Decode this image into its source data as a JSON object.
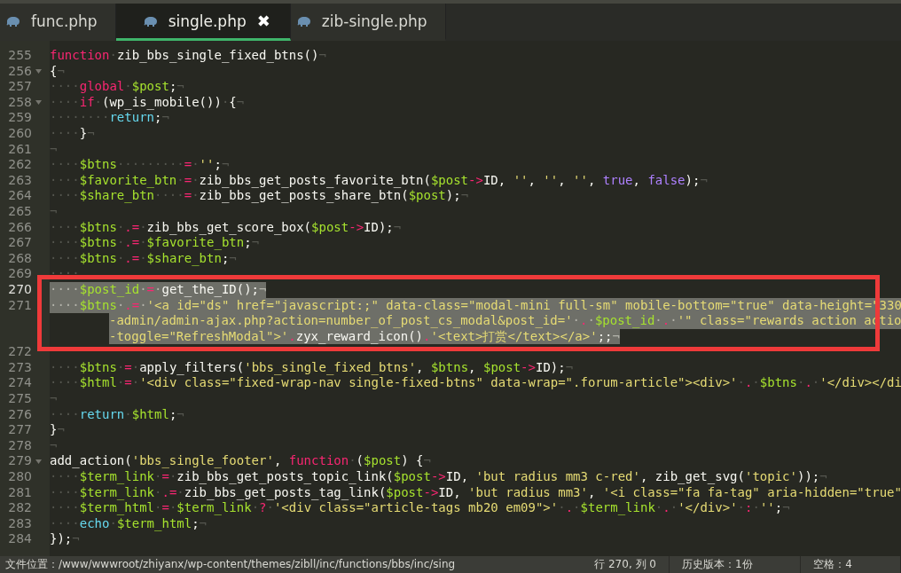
{
  "tabs": [
    {
      "label": "func.php",
      "selected": false,
      "closable": false
    },
    {
      "label": "single.php",
      "selected": true,
      "closable": true
    },
    {
      "label": "zib-single.php",
      "selected": false,
      "closable": false
    }
  ],
  "close_glyph": "✖",
  "editor": {
    "lines": [
      {
        "number": "255",
        "foldable": false,
        "current": false,
        "selected": false,
        "rows": [
          {
            "tokens": [
              {
                "kind": "keyword",
                "text": "function"
              },
              {
                "kind": "ws",
                "text": "·"
              },
              {
                "kind": "plain",
                "text": "zib_bbs_single_fixed_btns()"
              },
              {
                "kind": "ws",
                "text": "¬"
              }
            ]
          }
        ]
      },
      {
        "number": "256",
        "foldable": true,
        "current": false,
        "selected": false,
        "rows": [
          {
            "tokens": [
              {
                "kind": "plain",
                "text": "{"
              },
              {
                "kind": "ws",
                "text": "¬"
              }
            ]
          }
        ]
      },
      {
        "number": "257",
        "foldable": false,
        "current": false,
        "selected": false,
        "rows": [
          {
            "tokens": [
              {
                "kind": "ws",
                "text": "····"
              },
              {
                "kind": "keyword",
                "text": "global"
              },
              {
                "kind": "ws",
                "text": "·"
              },
              {
                "kind": "variable",
                "text": "$post"
              },
              {
                "kind": "plain",
                "text": ";"
              },
              {
                "kind": "ws",
                "text": "¬"
              }
            ]
          }
        ]
      },
      {
        "number": "258",
        "foldable": true,
        "current": false,
        "selected": false,
        "rows": [
          {
            "tokens": [
              {
                "kind": "ws",
                "text": "····"
              },
              {
                "kind": "keyword",
                "text": "if"
              },
              {
                "kind": "ws",
                "text": "·"
              },
              {
                "kind": "plain",
                "text": "(wp_is_mobile())"
              },
              {
                "kind": "ws",
                "text": "·"
              },
              {
                "kind": "plain",
                "text": "{"
              },
              {
                "kind": "ws",
                "text": "¬"
              }
            ]
          }
        ]
      },
      {
        "number": "259",
        "foldable": false,
        "current": false,
        "selected": false,
        "rows": [
          {
            "tokens": [
              {
                "kind": "ws",
                "text": "········"
              },
              {
                "kind": "control",
                "text": "return"
              },
              {
                "kind": "plain",
                "text": ";"
              },
              {
                "kind": "ws",
                "text": "¬"
              }
            ]
          }
        ]
      },
      {
        "number": "260",
        "foldable": false,
        "current": false,
        "selected": false,
        "rows": [
          {
            "tokens": [
              {
                "kind": "ws",
                "text": "····"
              },
              {
                "kind": "plain",
                "text": "}"
              },
              {
                "kind": "ws",
                "text": "¬"
              }
            ]
          }
        ]
      },
      {
        "number": "261",
        "foldable": false,
        "current": false,
        "selected": false,
        "rows": [
          {
            "tokens": [
              {
                "kind": "ws",
                "text": "¬"
              }
            ]
          }
        ]
      },
      {
        "number": "262",
        "foldable": false,
        "current": false,
        "selected": false,
        "rows": [
          {
            "tokens": [
              {
                "kind": "ws",
                "text": "····"
              },
              {
                "kind": "variable",
                "text": "$btns"
              },
              {
                "kind": "ws",
                "text": "·········"
              },
              {
                "kind": "operator",
                "text": "="
              },
              {
                "kind": "ws",
                "text": "·"
              },
              {
                "kind": "string",
                "text": "''"
              },
              {
                "kind": "plain",
                "text": ";"
              },
              {
                "kind": "ws",
                "text": "¬"
              }
            ]
          }
        ]
      },
      {
        "number": "263",
        "foldable": false,
        "current": false,
        "selected": false,
        "rows": [
          {
            "tokens": [
              {
                "kind": "ws",
                "text": "····"
              },
              {
                "kind": "variable",
                "text": "$favorite_btn"
              },
              {
                "kind": "ws",
                "text": "·"
              },
              {
                "kind": "operator",
                "text": "="
              },
              {
                "kind": "ws",
                "text": "·"
              },
              {
                "kind": "plain",
                "text": "zib_bbs_get_posts_favorite_btn("
              },
              {
                "kind": "variable",
                "text": "$post"
              },
              {
                "kind": "operator",
                "text": "->"
              },
              {
                "kind": "plain",
                "text": "ID, "
              },
              {
                "kind": "string",
                "text": "''"
              },
              {
                "kind": "plain",
                "text": ", "
              },
              {
                "kind": "string",
                "text": "''"
              },
              {
                "kind": "plain",
                "text": ", "
              },
              {
                "kind": "string",
                "text": "''"
              },
              {
                "kind": "plain",
                "text": ", "
              },
              {
                "kind": "constant",
                "text": "true"
              },
              {
                "kind": "plain",
                "text": ", "
              },
              {
                "kind": "constant",
                "text": "false"
              },
              {
                "kind": "plain",
                "text": ");"
              },
              {
                "kind": "ws",
                "text": "¬"
              }
            ]
          }
        ]
      },
      {
        "number": "264",
        "foldable": false,
        "current": false,
        "selected": false,
        "rows": [
          {
            "tokens": [
              {
                "kind": "ws",
                "text": "····"
              },
              {
                "kind": "variable",
                "text": "$share_btn"
              },
              {
                "kind": "ws",
                "text": "····"
              },
              {
                "kind": "operator",
                "text": "="
              },
              {
                "kind": "ws",
                "text": "·"
              },
              {
                "kind": "plain",
                "text": "zib_bbs_get_posts_share_btn("
              },
              {
                "kind": "variable",
                "text": "$post"
              },
              {
                "kind": "plain",
                "text": ");"
              },
              {
                "kind": "ws",
                "text": "¬"
              }
            ]
          }
        ]
      },
      {
        "number": "265",
        "foldable": false,
        "current": false,
        "selected": false,
        "rows": [
          {
            "tokens": [
              {
                "kind": "ws",
                "text": "¬"
              }
            ]
          }
        ]
      },
      {
        "number": "266",
        "foldable": false,
        "current": false,
        "selected": false,
        "rows": [
          {
            "tokens": [
              {
                "kind": "ws",
                "text": "····"
              },
              {
                "kind": "variable",
                "text": "$btns"
              },
              {
                "kind": "ws",
                "text": "·"
              },
              {
                "kind": "operator",
                "text": ".="
              },
              {
                "kind": "ws",
                "text": "·"
              },
              {
                "kind": "plain",
                "text": "zib_bbs_get_score_box("
              },
              {
                "kind": "variable",
                "text": "$post"
              },
              {
                "kind": "operator",
                "text": "->"
              },
              {
                "kind": "plain",
                "text": "ID);"
              },
              {
                "kind": "ws",
                "text": "¬"
              }
            ]
          }
        ]
      },
      {
        "number": "267",
        "foldable": false,
        "current": false,
        "selected": false,
        "rows": [
          {
            "tokens": [
              {
                "kind": "ws",
                "text": "····"
              },
              {
                "kind": "variable",
                "text": "$btns"
              },
              {
                "kind": "ws",
                "text": "·"
              },
              {
                "kind": "operator",
                "text": ".="
              },
              {
                "kind": "ws",
                "text": "·"
              },
              {
                "kind": "variable",
                "text": "$favorite_btn"
              },
              {
                "kind": "plain",
                "text": ";"
              },
              {
                "kind": "ws",
                "text": "¬"
              }
            ]
          }
        ]
      },
      {
        "number": "268",
        "foldable": false,
        "current": false,
        "selected": false,
        "rows": [
          {
            "tokens": [
              {
                "kind": "ws",
                "text": "····"
              },
              {
                "kind": "variable",
                "text": "$btns"
              },
              {
                "kind": "ws",
                "text": "·"
              },
              {
                "kind": "operator",
                "text": ".="
              },
              {
                "kind": "ws",
                "text": "·"
              },
              {
                "kind": "variable",
                "text": "$share_btn"
              },
              {
                "kind": "plain",
                "text": ";"
              },
              {
                "kind": "ws",
                "text": "¬"
              }
            ]
          }
        ]
      },
      {
        "number": "269",
        "foldable": false,
        "current": false,
        "selected": false,
        "rows": [
          {
            "tokens": [
              {
                "kind": "ws",
                "text": "····"
              }
            ]
          }
        ]
      },
      {
        "number": "270",
        "foldable": false,
        "current": true,
        "selected": true,
        "rows": [
          {
            "tokens": [
              {
                "kind": "ws",
                "text": "····"
              },
              {
                "kind": "variable",
                "text": "$post_id"
              },
              {
                "kind": "ws",
                "text": "·"
              },
              {
                "kind": "operator",
                "text": "="
              },
              {
                "kind": "ws",
                "text": "·"
              },
              {
                "kind": "plain",
                "text": "get_the_ID();"
              },
              {
                "kind": "ws",
                "text": "¬"
              }
            ]
          }
        ]
      },
      {
        "number": "271",
        "foldable": false,
        "current": false,
        "selected": true,
        "rows": [
          {
            "tokens": [
              {
                "kind": "ws",
                "text": "····"
              },
              {
                "kind": "variable",
                "text": "$btns"
              },
              {
                "kind": "ws",
                "text": "·"
              },
              {
                "kind": "operator",
                "text": ".="
              },
              {
                "kind": "ws",
                "text": "·"
              },
              {
                "kind": "string",
                "text": "'<a id=\"ds\" href=\"javascript:;\" data-class=\"modal-mini full-sm\" mobile-bottom=\"true\" data-height=\"330"
              }
            ]
          },
          {
            "tokens": [
              {
                "kind": "string",
                "text": "-admin/admin-ajax.php?action=number_of_post_cs_modal&post_id='"
              },
              {
                "kind": "ws",
                "text": "·"
              },
              {
                "kind": "operator",
                "text": "."
              },
              {
                "kind": "ws",
                "text": "·"
              },
              {
                "kind": "variable",
                "text": "$post_id"
              },
              {
                "kind": "ws",
                "text": "·"
              },
              {
                "kind": "operator",
                "text": "."
              },
              {
                "kind": "ws",
                "text": "·"
              },
              {
                "kind": "string",
                "text": "'\" class=\"rewards action actio"
              }
            ]
          },
          {
            "tokens": [
              {
                "kind": "string",
                "text": "-toggle=\"RefreshModal\">'"
              },
              {
                "kind": "operator",
                "text": "."
              },
              {
                "kind": "plain",
                "text": "zyx_reward_icon()"
              },
              {
                "kind": "operator",
                "text": "."
              },
              {
                "kind": "string",
                "text": "'<text>打赏</text></a>'"
              },
              {
                "kind": "plain",
                "text": ";;"
              },
              {
                "kind": "ws",
                "text": "¬"
              }
            ]
          }
        ]
      },
      {
        "number": "272",
        "foldable": false,
        "current": false,
        "selected": false
      },
      {
        "number": "273",
        "foldable": false,
        "current": false,
        "selected": false,
        "rows": [
          {
            "tokens": [
              {
                "kind": "ws",
                "text": "····"
              },
              {
                "kind": "variable",
                "text": "$btns"
              },
              {
                "kind": "ws",
                "text": "·"
              },
              {
                "kind": "operator",
                "text": "="
              },
              {
                "kind": "ws",
                "text": "·"
              },
              {
                "kind": "plain",
                "text": "apply_filters("
              },
              {
                "kind": "string",
                "text": "'bbs_single_fixed_btns'"
              },
              {
                "kind": "plain",
                "text": ", "
              },
              {
                "kind": "variable",
                "text": "$btns"
              },
              {
                "kind": "plain",
                "text": ", "
              },
              {
                "kind": "variable",
                "text": "$post"
              },
              {
                "kind": "operator",
                "text": "->"
              },
              {
                "kind": "plain",
                "text": "ID);"
              },
              {
                "kind": "ws",
                "text": "¬"
              }
            ]
          }
        ]
      },
      {
        "number": "274",
        "foldable": false,
        "current": false,
        "selected": false,
        "rows": [
          {
            "tokens": [
              {
                "kind": "ws",
                "text": "····"
              },
              {
                "kind": "variable",
                "text": "$html"
              },
              {
                "kind": "ws",
                "text": "·"
              },
              {
                "kind": "operator",
                "text": "="
              },
              {
                "kind": "ws",
                "text": "·"
              },
              {
                "kind": "string",
                "text": "'<div class=\"fixed-wrap-nav single-fixed-btns\" data-wrap=\".forum-article\"><div>'"
              },
              {
                "kind": "ws",
                "text": "·"
              },
              {
                "kind": "operator",
                "text": "."
              },
              {
                "kind": "ws",
                "text": "·"
              },
              {
                "kind": "variable",
                "text": "$btns"
              },
              {
                "kind": "ws",
                "text": "·"
              },
              {
                "kind": "operator",
                "text": "."
              },
              {
                "kind": "ws",
                "text": "·"
              },
              {
                "kind": "string",
                "text": "'</div></di"
              }
            ]
          }
        ]
      },
      {
        "number": "275",
        "foldable": false,
        "current": false,
        "selected": false,
        "rows": [
          {
            "tokens": [
              {
                "kind": "ws",
                "text": "¬"
              }
            ]
          }
        ]
      },
      {
        "number": "276",
        "foldable": false,
        "current": false,
        "selected": false,
        "rows": [
          {
            "tokens": [
              {
                "kind": "ws",
                "text": "····"
              },
              {
                "kind": "control",
                "text": "return"
              },
              {
                "kind": "ws",
                "text": "·"
              },
              {
                "kind": "variable",
                "text": "$html"
              },
              {
                "kind": "plain",
                "text": ";"
              },
              {
                "kind": "ws",
                "text": "¬"
              }
            ]
          }
        ]
      },
      {
        "number": "277",
        "foldable": false,
        "current": false,
        "selected": false,
        "rows": [
          {
            "tokens": [
              {
                "kind": "plain",
                "text": "}"
              },
              {
                "kind": "ws",
                "text": "¬"
              }
            ]
          }
        ]
      },
      {
        "number": "278",
        "foldable": false,
        "current": false,
        "selected": false,
        "rows": [
          {
            "tokens": [
              {
                "kind": "ws",
                "text": "¬"
              }
            ]
          }
        ]
      },
      {
        "number": "279",
        "foldable": true,
        "current": false,
        "selected": false,
        "rows": [
          {
            "tokens": [
              {
                "kind": "plain",
                "text": "add_action("
              },
              {
                "kind": "string",
                "text": "'bbs_single_footer'"
              },
              {
                "kind": "plain",
                "text": ", "
              },
              {
                "kind": "keyword",
                "text": "function"
              },
              {
                "kind": "ws",
                "text": "·"
              },
              {
                "kind": "plain",
                "text": "("
              },
              {
                "kind": "variable",
                "text": "$post"
              },
              {
                "kind": "plain",
                "text": ") {"
              },
              {
                "kind": "ws",
                "text": "¬"
              }
            ]
          }
        ]
      },
      {
        "number": "280",
        "foldable": false,
        "current": false,
        "selected": false,
        "rows": [
          {
            "tokens": [
              {
                "kind": "ws",
                "text": "····"
              },
              {
                "kind": "variable",
                "text": "$term_link"
              },
              {
                "kind": "ws",
                "text": "·"
              },
              {
                "kind": "operator",
                "text": "="
              },
              {
                "kind": "ws",
                "text": "·"
              },
              {
                "kind": "plain",
                "text": "zib_bbs_get_posts_topic_link("
              },
              {
                "kind": "variable",
                "text": "$post"
              },
              {
                "kind": "operator",
                "text": "->"
              },
              {
                "kind": "plain",
                "text": "ID, "
              },
              {
                "kind": "string",
                "text": "'but radius mm3 c-red'"
              },
              {
                "kind": "plain",
                "text": ", zib_get_svg("
              },
              {
                "kind": "string",
                "text": "'topic'"
              },
              {
                "kind": "plain",
                "text": "));"
              },
              {
                "kind": "ws",
                "text": "¬"
              }
            ]
          }
        ]
      },
      {
        "number": "281",
        "foldable": false,
        "current": false,
        "selected": false,
        "rows": [
          {
            "tokens": [
              {
                "kind": "ws",
                "text": "····"
              },
              {
                "kind": "variable",
                "text": "$term_link"
              },
              {
                "kind": "ws",
                "text": "·"
              },
              {
                "kind": "operator",
                "text": ".="
              },
              {
                "kind": "ws",
                "text": "·"
              },
              {
                "kind": "plain",
                "text": "zib_bbs_get_posts_tag_link("
              },
              {
                "kind": "variable",
                "text": "$post"
              },
              {
                "kind": "operator",
                "text": "->"
              },
              {
                "kind": "plain",
                "text": "ID, "
              },
              {
                "kind": "string",
                "text": "'but radius mm3'"
              },
              {
                "kind": "plain",
                "text": ", "
              },
              {
                "kind": "string",
                "text": "'<i class=\"fa fa-tag\" aria-hidden=\"true\""
              }
            ]
          }
        ]
      },
      {
        "number": "282",
        "foldable": false,
        "current": false,
        "selected": false,
        "rows": [
          {
            "tokens": [
              {
                "kind": "ws",
                "text": "····"
              },
              {
                "kind": "variable",
                "text": "$term_html"
              },
              {
                "kind": "ws",
                "text": "·"
              },
              {
                "kind": "operator",
                "text": "="
              },
              {
                "kind": "ws",
                "text": "·"
              },
              {
                "kind": "variable",
                "text": "$term_link"
              },
              {
                "kind": "ws",
                "text": "·"
              },
              {
                "kind": "operator",
                "text": "?"
              },
              {
                "kind": "ws",
                "text": "·"
              },
              {
                "kind": "string",
                "text": "'<div class=\"article-tags mb20 em09\">'"
              },
              {
                "kind": "ws",
                "text": "·"
              },
              {
                "kind": "operator",
                "text": "."
              },
              {
                "kind": "ws",
                "text": "·"
              },
              {
                "kind": "variable",
                "text": "$term_link"
              },
              {
                "kind": "ws",
                "text": "·"
              },
              {
                "kind": "operator",
                "text": "."
              },
              {
                "kind": "ws",
                "text": "·"
              },
              {
                "kind": "string",
                "text": "'</div>'"
              },
              {
                "kind": "ws",
                "text": "·"
              },
              {
                "kind": "operator",
                "text": ":"
              },
              {
                "kind": "ws",
                "text": "·"
              },
              {
                "kind": "string",
                "text": "''"
              },
              {
                "kind": "plain",
                "text": ";"
              },
              {
                "kind": "ws",
                "text": "¬"
              }
            ]
          }
        ]
      },
      {
        "number": "283",
        "foldable": false,
        "current": false,
        "selected": false,
        "rows": [
          {
            "tokens": [
              {
                "kind": "ws",
                "text": "····"
              },
              {
                "kind": "control",
                "text": "echo"
              },
              {
                "kind": "ws",
                "text": "·"
              },
              {
                "kind": "variable",
                "text": "$term_html"
              },
              {
                "kind": "plain",
                "text": ";"
              },
              {
                "kind": "ws",
                "text": "¬"
              }
            ]
          }
        ]
      },
      {
        "number": "284",
        "foldable": false,
        "current": false,
        "selected": false,
        "rows": [
          {
            "tokens": [
              {
                "kind": "plain",
                "text": "});"
              },
              {
                "kind": "ws",
                "text": "¬"
              }
            ]
          }
        ]
      }
    ]
  },
  "status_bar": {
    "file_location": "文件位置：/www/wwwroot/zhiyanx/wp-content/themes/zibll/inc/functions/bbs/inc/sing",
    "cursor": "行 270, 列 0",
    "history": "历史版本：1份",
    "indent": "空格：4"
  }
}
